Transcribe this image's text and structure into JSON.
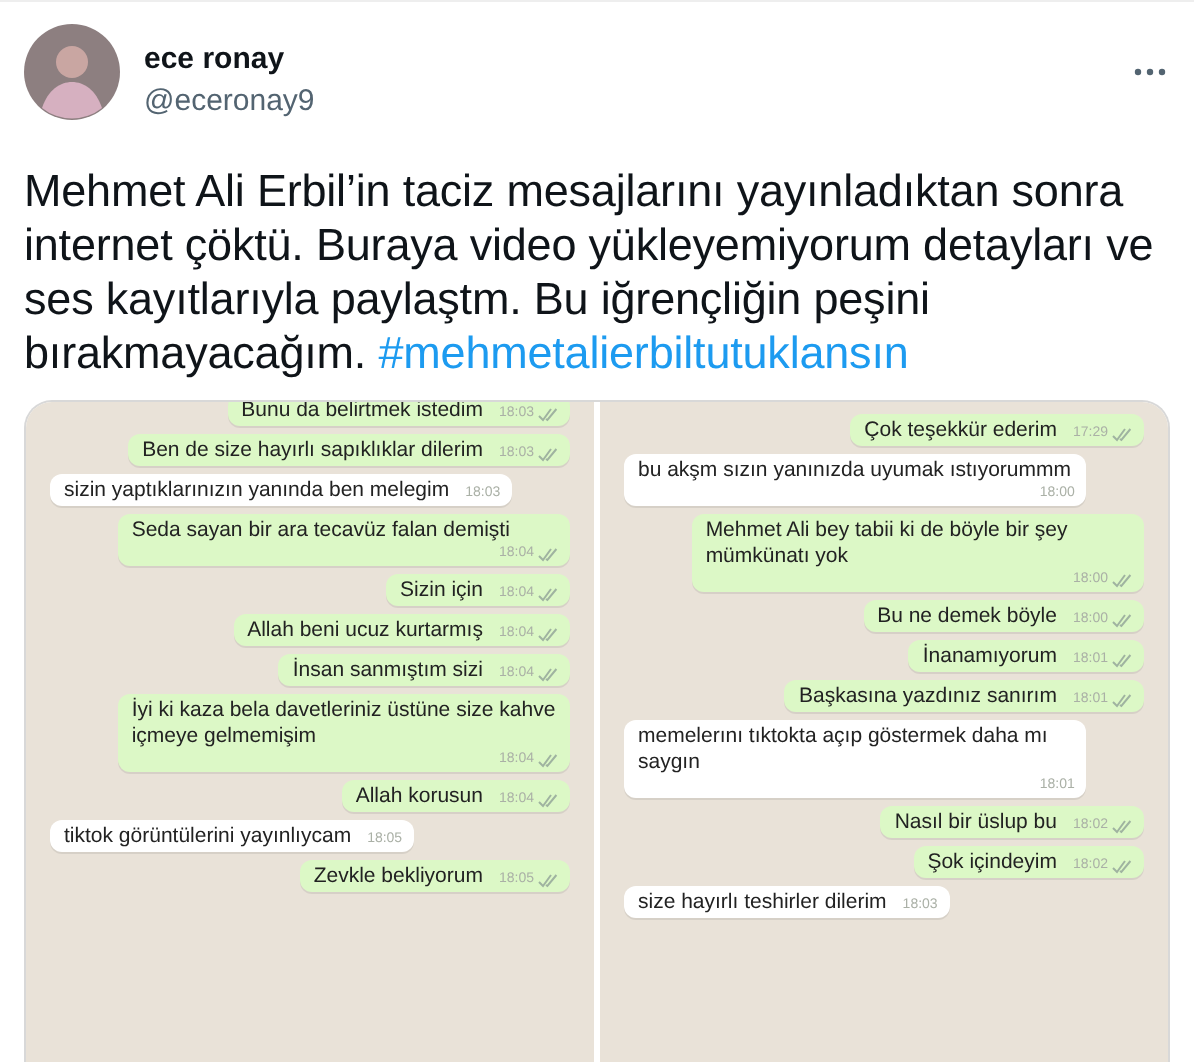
{
  "author": {
    "name": "ece ronay",
    "handle": "@eceronay9"
  },
  "tweet": {
    "text": "Mehmet Ali Erbil’in taciz mesajlarını yayınladıktan sonra internet çöktü. Buraya video yükleyemiyorum detayları ve ses kayıtlarıyla paylaştm. Bu iğrençliğin peşini bırakmayacağım.",
    "hashtag": "#mehmetalierbiltutuklansın"
  },
  "chats": [
    {
      "messages": [
        {
          "kind": "sent",
          "text": "Bunu da belirtmek istedim",
          "time": "18:03"
        },
        {
          "kind": "sent",
          "text": "Ben de size hayırlı sapıklıklar dilerim",
          "time": "18:03"
        },
        {
          "kind": "received",
          "text": "sizin yaptıklarınızın yanında ben melegim",
          "time": "18:03"
        },
        {
          "kind": "sent",
          "text": "Seda sayan bir ara tecavüz falan demişti",
          "time": "18:04"
        },
        {
          "kind": "sent",
          "text": "Sizin için",
          "time": "18:04"
        },
        {
          "kind": "sent",
          "text": "Allah beni ucuz kurtarmış",
          "time": "18:04"
        },
        {
          "kind": "sent",
          "text": "İnsan sanmıştım sizi",
          "time": "18:04"
        },
        {
          "kind": "sent",
          "text": "İyi ki kaza bela davetleriniz üstüne size kahve içmeye gelmemişim",
          "time": "18:04"
        },
        {
          "kind": "sent",
          "text": "Allah korusun",
          "time": "18:04"
        },
        {
          "kind": "received",
          "text": "tiktok görüntülerini yayınlıycam",
          "time": "18:05"
        },
        {
          "kind": "sent",
          "text": "Zevkle bekliyorum",
          "time": "18:05"
        }
      ]
    },
    {
      "messages": [
        {
          "kind": "sent",
          "text": "Çok teşekkür ederim",
          "time": "17:29"
        },
        {
          "kind": "received",
          "text": "bu akşm sızın yanınızda uyumak ıstıyorummm",
          "time": "18:00"
        },
        {
          "kind": "sent",
          "text": "Mehmet Ali bey tabii ki de böyle bir şey mümkünatı yok",
          "time": "18:00"
        },
        {
          "kind": "sent",
          "text": "Bu ne demek böyle",
          "time": "18:00"
        },
        {
          "kind": "sent",
          "text": "İnanamıyorum",
          "time": "18:01"
        },
        {
          "kind": "sent",
          "text": "Başkasına yazdınız sanırım",
          "time": "18:01"
        },
        {
          "kind": "received",
          "text": "memelerını tıktokta açıp göstermek daha mı saygın",
          "time": "18:01"
        },
        {
          "kind": "sent",
          "text": "Nasıl bir üslup bu",
          "time": "18:02"
        },
        {
          "kind": "sent",
          "text": "Şok içindeyim",
          "time": "18:02"
        },
        {
          "kind": "received",
          "text": "size hayırlı teshirler dilerim",
          "time": "18:03"
        }
      ]
    }
  ]
}
